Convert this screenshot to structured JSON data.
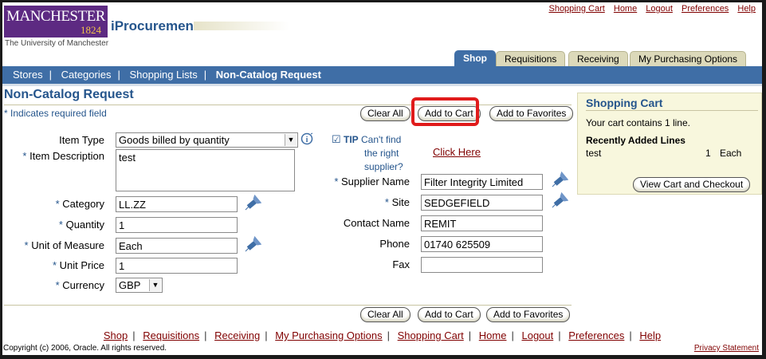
{
  "branding": {
    "logo_text": "MANCHESTER",
    "logo_year": "1824",
    "university": "The University of Manchester",
    "app_title": "iProcurement"
  },
  "global_links": [
    "Shopping Cart",
    "Home",
    "Logout",
    "Preferences",
    "Help"
  ],
  "tabs": [
    {
      "label": "Shop",
      "active": true
    },
    {
      "label": "Requisitions",
      "active": false
    },
    {
      "label": "Receiving",
      "active": false
    },
    {
      "label": "My Purchasing Options",
      "active": false
    }
  ],
  "subnav": {
    "items": [
      "Stores",
      "Categories",
      "Shopping Lists"
    ],
    "current": "Non-Catalog Request"
  },
  "page": {
    "title": "Non-Catalog Request",
    "required_note": "Indicates required field",
    "star": "*"
  },
  "buttons": {
    "clear_all": "Clear All",
    "add_to_cart": "Add to Cart",
    "add_to_favorites": "Add to Favorites",
    "view_cart": "View Cart and Checkout"
  },
  "form": {
    "item_type": {
      "label": "Item Type",
      "value": "Goods billed by quantity"
    },
    "item_description": {
      "label": "Item Description",
      "value": "test"
    },
    "category": {
      "label": "Category",
      "value": "LL.ZZ"
    },
    "quantity": {
      "label": "Quantity",
      "value": "1"
    },
    "unit_of_measure": {
      "label": "Unit of Measure",
      "value": "Each"
    },
    "unit_price": {
      "label": "Unit Price",
      "value": "1"
    },
    "currency": {
      "label": "Currency",
      "value": "GBP"
    },
    "supplier_name": {
      "label": "Supplier Name",
      "value": "Filter Integrity Limited"
    },
    "site": {
      "label": "Site",
      "value": "SEDGEFIELD"
    },
    "contact_name": {
      "label": "Contact Name",
      "value": "REMIT"
    },
    "phone": {
      "label": "Phone",
      "value": "01740 625509"
    },
    "fax": {
      "label": "Fax",
      "value": ""
    }
  },
  "tip": {
    "label": "TIP",
    "line1": "Can't find",
    "line2": "the right",
    "line3": "supplier?",
    "link": "Click Here"
  },
  "cart": {
    "title": "Shopping Cart",
    "summary": "Your cart contains 1 line.",
    "recent_heading": "Recently Added Lines",
    "recent_item": "test",
    "recent_qty": "1",
    "recent_uom": "Each"
  },
  "footer": {
    "links": [
      "Shop",
      "Requisitions",
      "Receiving",
      "My Purchasing Options",
      "Shopping Cart",
      "Home",
      "Logout",
      "Preferences",
      "Help"
    ],
    "copyright": "Copyright (c) 2006, Oracle. All rights reserved.",
    "privacy": "Privacy Statement"
  },
  "colors": {
    "accent_blue": "#3f6ea6",
    "title_blue": "#25558c",
    "link_maroon": "#800000",
    "tab_tan": "#dcd9ba",
    "highlight_red": "#e01b1b"
  }
}
